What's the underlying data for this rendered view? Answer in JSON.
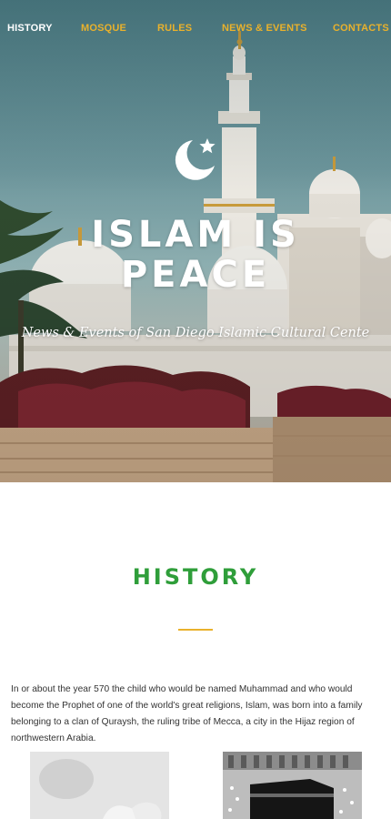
{
  "nav": {
    "items": [
      {
        "label": "HISTORY",
        "active": true
      },
      {
        "label": "MOSQUE",
        "active": false
      },
      {
        "label": "RULES",
        "active": false
      },
      {
        "label": "NEWS & EVENTS",
        "active": false
      },
      {
        "label": "CONTACTS",
        "active": false
      }
    ]
  },
  "hero": {
    "icon": "crescent-star-icon",
    "title_line1": "ISLAM IS",
    "title_line2": "PEACE",
    "subtitle": "News & Events of San Diego Islamic Cultural Cente"
  },
  "history": {
    "title": "HISTORY",
    "paragraph": "In or about the year 570 the child who would be named Muhammad and who would become the Prophet of one of the world's great religions, Islam, was born into a family belonging to a clan of Quraysh, the ruling tribe of Mecca, a city in the Hijaz region of northwestern Arabia."
  },
  "colors": {
    "accent": "#e9b12c",
    "heading_green": "#2f9e3a",
    "text": "#333333"
  }
}
